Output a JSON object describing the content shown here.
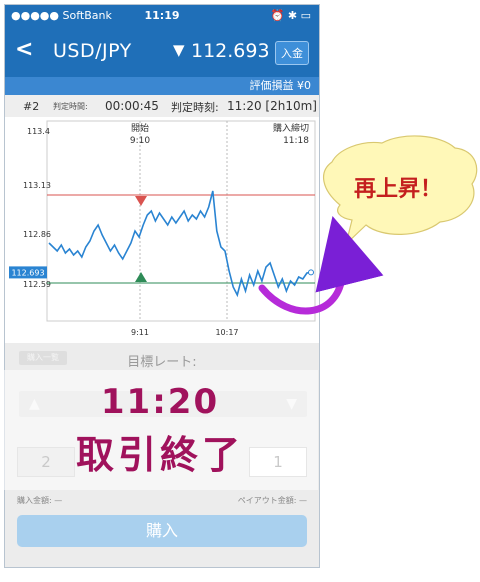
{
  "status_bar": {
    "carrier": "●●●●● SoftBank",
    "time": "11:19",
    "right": "⏰ ✱ ▭"
  },
  "header": {
    "back_glyph": "<",
    "pair": "USD/JPY",
    "direction_glyph": "▼",
    "price": "112.693",
    "deposit_label": "入金"
  },
  "pnl": {
    "label": "評価損益",
    "value": "¥0"
  },
  "info": {
    "round": "#2",
    "duration_label": "判定時間:",
    "duration": "00:00:45",
    "judge_time_label": "判定時刻:",
    "judge_time": "11:20 [2h10m]"
  },
  "chart": {
    "y_ticks": [
      "113.4",
      "113.13",
      "112.86",
      "112.59"
    ],
    "x_ticks": [
      "9:11",
      "10:17"
    ],
    "current_price_tag": "112.693",
    "start_label": "開始",
    "start_time": "9:10",
    "close_label": "購入締切",
    "close_time": "11:18"
  },
  "chart_data": {
    "type": "line",
    "ylim": [
      112.45,
      113.45
    ],
    "y_ticks": [
      113.4,
      113.13,
      112.86,
      112.59
    ],
    "x_ticks": [
      "9:11",
      "10:17"
    ],
    "upper_line": 113.08,
    "lower_line": 112.64,
    "current_price": 112.693,
    "series": [
      {
        "values": [
          112.84,
          112.82,
          112.8,
          112.83,
          112.79,
          112.81,
          112.78,
          112.8,
          112.77,
          112.82,
          112.85,
          112.9,
          112.93,
          112.88,
          112.84,
          112.8,
          112.83,
          112.79,
          112.76,
          112.8,
          112.84,
          112.9,
          112.87,
          112.93,
          112.98,
          113.0,
          112.95,
          112.99,
          112.96,
          112.93,
          112.97,
          112.94,
          112.97,
          113.0,
          112.95,
          112.98,
          112.96,
          113.0,
          112.97,
          113.02,
          113.1,
          112.9,
          112.82,
          112.8,
          112.7,
          112.62,
          112.58,
          112.66,
          112.6,
          112.68,
          112.63,
          112.7,
          112.65,
          112.72,
          112.74,
          112.68,
          112.62,
          112.66,
          112.6,
          112.65,
          112.63,
          112.67,
          112.66,
          112.69,
          112.693
        ]
      }
    ]
  },
  "lower_panel": {
    "pill": "購入一覧",
    "target_rate_label": "目標レート:",
    "bet_left": "2",
    "bet_right": "1",
    "amount_label": "購入金額: —",
    "payout_label": "ペイアウト金額: —",
    "buy_label": "購入"
  },
  "overlay": {
    "time": "11:20",
    "label": "取引終了"
  },
  "callout": {
    "text": "再上昇！"
  },
  "colors": {
    "header_blue": "#1f6fb8",
    "accent_magenta": "#a0125c",
    "bubble_fill": "#fff8b8",
    "upper_line": "#d9534f",
    "lower_line": "#2e8b57",
    "series": "#2a84d2"
  }
}
